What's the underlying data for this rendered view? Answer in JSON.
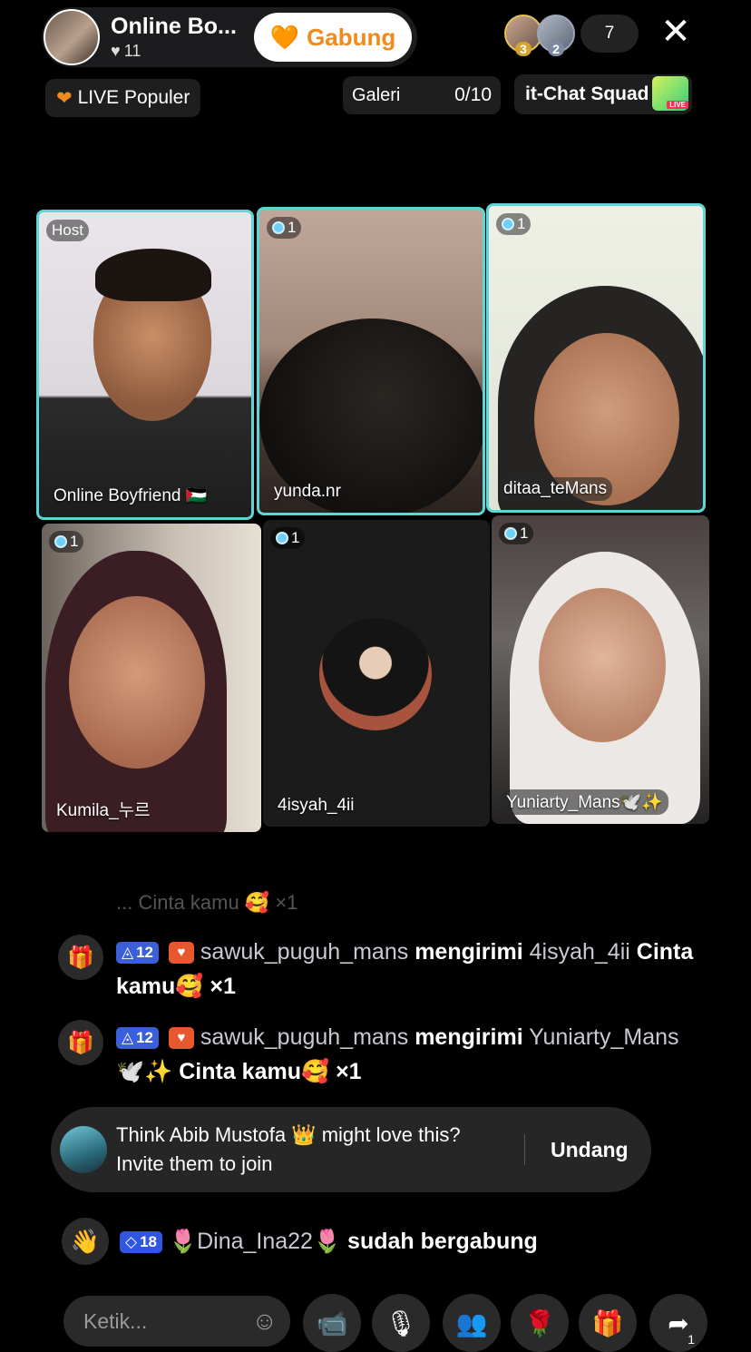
{
  "header": {
    "host_name": "Online Bo...",
    "likes": "11",
    "join_label": "Gabung",
    "viewer_badges": [
      "3",
      "2"
    ],
    "viewer_count": "7"
  },
  "pills": {
    "live_populer": "LIVE Populer",
    "galeri_label": "Galeri",
    "galeri_count": "0/10",
    "chat_squad": "it-Chat Squad",
    "live_tag": "LIVE"
  },
  "grid": {
    "host_badge": "Host",
    "tiles": [
      {
        "name": "Online Boyfriend 🇵🇸",
        "level": ""
      },
      {
        "name": "yunda.nr",
        "level": "1"
      },
      {
        "name": "ditaa_teMans",
        "level": "1"
      },
      {
        "name": "Kumila_누르",
        "level": "1"
      },
      {
        "name": "4isyah_4ii",
        "level": "1"
      },
      {
        "name": "Yuniarty_Mans🕊️✨",
        "level": "1"
      }
    ]
  },
  "chat": {
    "faded": "... Cinta kamu 🥰 ×1",
    "gifts": [
      {
        "level": "12",
        "user": "sawuk_puguh_mans",
        "verb": "mengirimi",
        "recipient": "4isyah_4ii",
        "gift": "Cinta kamu",
        "emoji": "🥰",
        "count": "×1"
      },
      {
        "level": "12",
        "user": "sawuk_puguh_mans",
        "verb": "mengirimi",
        "recipient": "Yuniarty_Mans🕊️✨",
        "gift": "Cinta kamu",
        "emoji": "🥰",
        "count": "×1"
      }
    ],
    "invite": {
      "line1": "Think Abib Mustofa 👑 might love this?",
      "line2": "Invite them to join",
      "action": "Undang"
    },
    "join": {
      "level": "18",
      "user": "🌷Dina_Ina22🌷",
      "text": "sudah bergabung"
    }
  },
  "bottom": {
    "comment_placeholder": "Ketik...",
    "share_count": "1"
  }
}
